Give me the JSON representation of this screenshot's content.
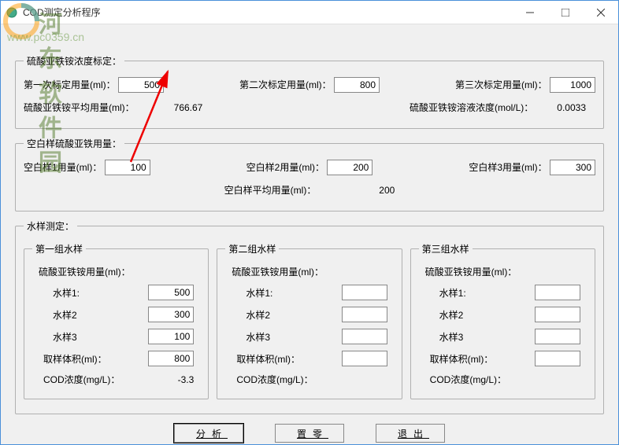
{
  "window": {
    "title": "COD测定分析程序"
  },
  "watermark": {
    "main": "河东软件园",
    "sub": "www.pc0359.cn"
  },
  "group1": {
    "legend": "硫酸亚铁铵浓度标定：",
    "cal1_label": "第一次标定用量(ml)：",
    "cal1_value": "500",
    "cal2_label": "第二次标定用量(ml)：",
    "cal2_value": "800",
    "cal3_label": "第三次标定用量(ml)：",
    "cal3_value": "1000",
    "avg_label": "硫酸亚铁铵平均用量(ml)：",
    "avg_value": "766.67",
    "conc_label": "硫酸亚铁铵溶液浓度(mol/L)：",
    "conc_value": "0.0033"
  },
  "group2": {
    "legend": "空白样硫酸亚铁用量：",
    "blank1_label": "空白样1用量(ml)：",
    "blank1_value": "100",
    "blank2_label": "空白样2用量(ml)：",
    "blank2_value": "200",
    "blank3_label": "空白样3用量(ml)：",
    "blank3_value": "300",
    "avg_label": "空白样平均用量(ml)：",
    "avg_value": "200"
  },
  "group3": {
    "legend": "水样测定：",
    "g1": {
      "legend": "第一组水样",
      "header": "硫酸亚铁铵用量(ml)：",
      "s1_label": "水样1:",
      "s1_value": "500",
      "s2_label": "水样2",
      "s2_value": "300",
      "s3_label": "水样3",
      "s3_value": "100",
      "vol_label": "取样体积(ml)：",
      "vol_value": "800",
      "cod_label": "COD浓度(mg/L)：",
      "cod_value": "-3.3"
    },
    "g2": {
      "legend": "第二组水样",
      "header": "硫酸亚铁铵用量(ml)：",
      "s1_label": "水样1:",
      "s1_value": "",
      "s2_label": "水样2",
      "s2_value": "",
      "s3_label": "水样3",
      "s3_value": "",
      "vol_label": "取样体积(ml)：",
      "vol_value": "",
      "cod_label": "COD浓度(mg/L)：",
      "cod_value": ""
    },
    "g3": {
      "legend": "第三组水样",
      "header": "硫酸亚铁铵用量(ml)：",
      "s1_label": "水样1:",
      "s1_value": "",
      "s2_label": "水样2",
      "s2_value": "",
      "s3_label": "水样3",
      "s3_value": "",
      "vol_label": "取样体积(ml)：",
      "vol_value": "",
      "cod_label": "COD浓度(mg/L)：",
      "cod_value": ""
    }
  },
  "buttons": {
    "analyze": "分析",
    "zero": "置零",
    "exit": "退出"
  }
}
